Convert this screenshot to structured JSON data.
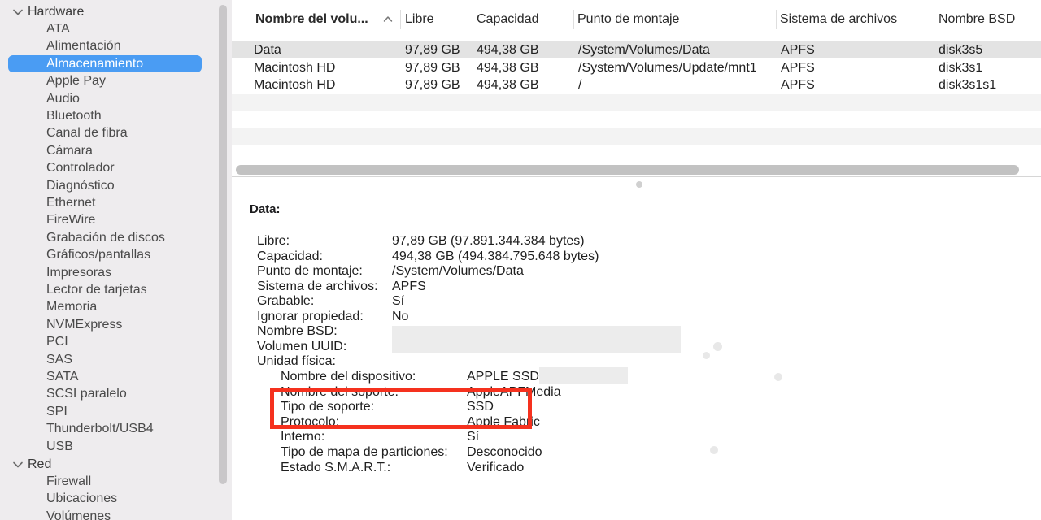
{
  "sidebar": {
    "groups": [
      {
        "label": "Hardware"
      },
      {
        "label": "Red"
      }
    ],
    "hardware_items": [
      "ATA",
      "Alimentación",
      "Almacenamiento",
      "Apple Pay",
      "Audio",
      "Bluetooth",
      "Canal de fibra",
      "Cámara",
      "Controlador",
      "Diagnóstico",
      "Ethernet",
      "FireWire",
      "Grabación de discos",
      "Gráficos/pantallas",
      "Impresoras",
      "Lector de tarjetas",
      "Memoria",
      "NVMExpress",
      "PCI",
      "SAS",
      "SATA",
      "SCSI paralelo",
      "SPI",
      "Thunderbolt/USB4",
      "USB"
    ],
    "red_items": [
      "Firewall",
      "Ubicaciones",
      "Volúmenes"
    ],
    "selected": "Almacenamiento"
  },
  "table": {
    "columns": [
      "Nombre del volu...",
      "Libre",
      "Capacidad",
      "Punto de montaje",
      "Sistema de archivos",
      "Nombre BSD"
    ],
    "rows": [
      [
        "Data",
        "97,89 GB",
        "494,38 GB",
        "/System/Volumes/Data",
        "APFS",
        "disk3s5"
      ],
      [
        "Macintosh HD",
        "97,89 GB",
        "494,38 GB",
        "/System/Volumes/Update/mnt1",
        "APFS",
        "disk3s1"
      ],
      [
        "Macintosh HD",
        "97,89 GB",
        "494,38 GB",
        "/",
        "APFS",
        "disk3s1s1"
      ]
    ]
  },
  "detail": {
    "title": "Data:",
    "fields": [
      {
        "label": "Libre:",
        "value": "97,89 GB (97.891.344.384 bytes)"
      },
      {
        "label": "Capacidad:",
        "value": "494,38 GB (494.384.795.648 bytes)"
      },
      {
        "label": "Punto de montaje:",
        "value": "/System/Volumes/Data"
      },
      {
        "label": "Sistema de archivos:",
        "value": "APFS"
      },
      {
        "label": "Grabable:",
        "value": "Sí"
      },
      {
        "label": "Ignorar propiedad:",
        "value": "No"
      },
      {
        "label": "Nombre BSD:",
        "value": ""
      },
      {
        "label": "Volumen UUID:",
        "value": ""
      },
      {
        "label": "Unidad física:",
        "value": ""
      }
    ],
    "physical": [
      {
        "label": "Nombre del dispositivo:",
        "value": "APPLE SSD"
      },
      {
        "label": "Nombre del soporte:",
        "value": "AppleAPFMedia"
      },
      {
        "label": "Tipo de soporte:",
        "value": "SSD"
      },
      {
        "label": "Protocolo:",
        "value": "Apple Fabric"
      },
      {
        "label": "Interno:",
        "value": "Sí"
      },
      {
        "label": "Tipo de mapa de particiones:",
        "value": "Desconocido"
      },
      {
        "label": "Estado S.M.A.R.T.:",
        "value": "Verificado"
      }
    ]
  },
  "colors": {
    "selection": "#4a9cf3",
    "highlight_box": "#f5311e"
  }
}
